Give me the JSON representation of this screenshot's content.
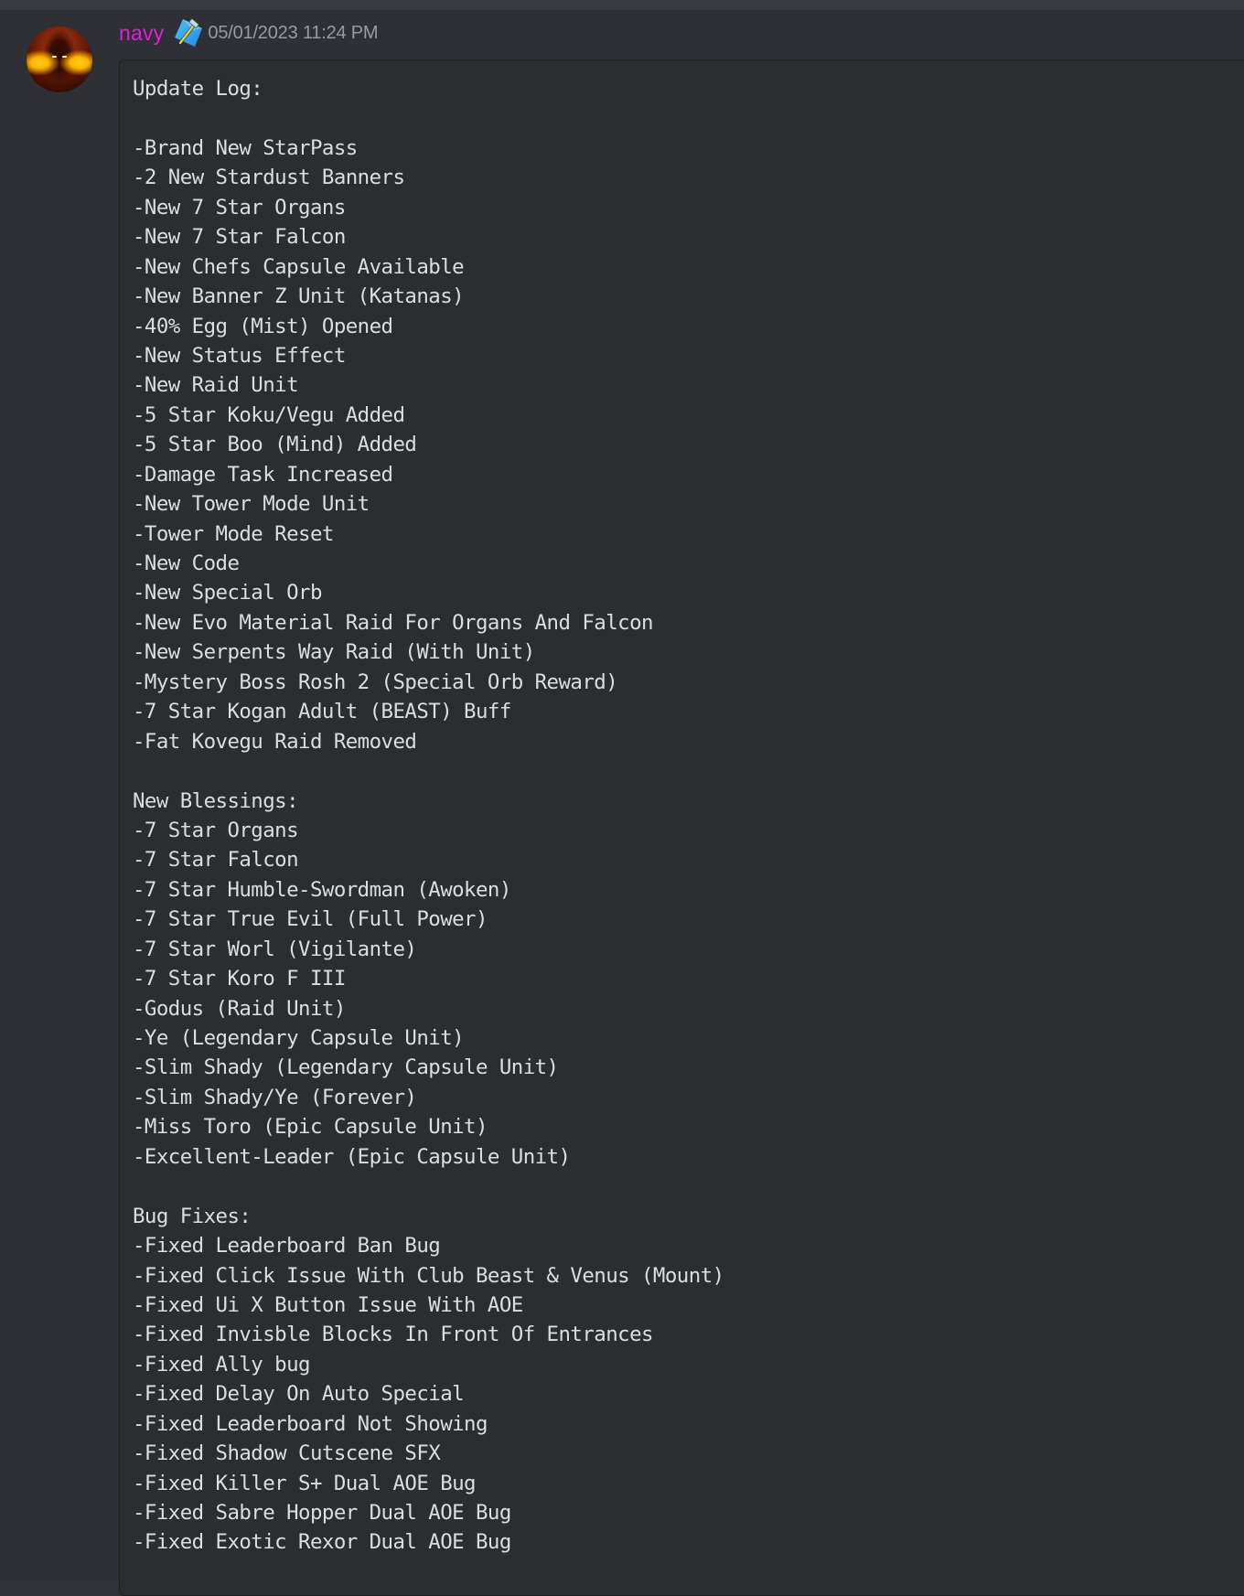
{
  "message": {
    "author": {
      "username": "navy",
      "username_color": "#e11ee0",
      "badge_icon": "developer-hammer-badge-icon",
      "avatar": "user-avatar"
    },
    "timestamp": "05/01/2023 11:24 PM",
    "code_block": {
      "lines": [
        "Update Log:",
        "",
        "-Brand New StarPass",
        "-2 New Stardust Banners",
        "-New 7 Star Organs",
        "-New 7 Star Falcon",
        "-New Chefs Capsule Available",
        "-New Banner Z Unit (Katanas)",
        "-40% Egg (Mist) Opened",
        "-New Status Effect",
        "-New Raid Unit",
        "-5 Star Koku/Vegu Added",
        "-5 Star Boo (Mind) Added",
        "-Damage Task Increased",
        "-New Tower Mode Unit",
        "-Tower Mode Reset",
        "-New Code",
        "-New Special Orb",
        "-New Evo Material Raid For Organs And Falcon",
        "-New Serpents Way Raid (With Unit)",
        "-Mystery Boss Rosh 2 (Special Orb Reward)",
        "-7 Star Kogan Adult (BEAST) Buff",
        "-Fat Kovegu Raid Removed",
        "",
        "New Blessings:",
        "-7 Star Organs",
        "-7 Star Falcon",
        "-7 Star Humble-Swordman (Awoken)",
        "-7 Star True Evil (Full Power)",
        "-7 Star Worl (Vigilante)",
        "-7 Star Koro F III",
        "-Godus (Raid Unit)",
        "-Ye (Legendary Capsule Unit)",
        "-Slim Shady (Legendary Capsule Unit)",
        "-Slim Shady/Ye (Forever)",
        "-Miss Toro (Epic Capsule Unit)",
        "-Excellent-Leader (Epic Capsule Unit)",
        "",
        "Bug Fixes:",
        "-Fixed Leaderboard Ban Bug",
        "-Fixed Click Issue With Club Beast & Venus (Mount)",
        "-Fixed Ui X Button Issue With AOE",
        "-Fixed Invisble Blocks In Front Of Entrances",
        "-Fixed Ally bug",
        "-Fixed Delay On Auto Special",
        "-Fixed Leaderboard Not Showing",
        "-Fixed Shadow Cutscene SFX",
        "-Fixed Killer S+ Dual AOE Bug",
        "-Fixed Sabre Hopper Dual AOE Bug",
        "-Fixed Exotic Rexor Dual AOE Bug"
      ]
    }
  }
}
